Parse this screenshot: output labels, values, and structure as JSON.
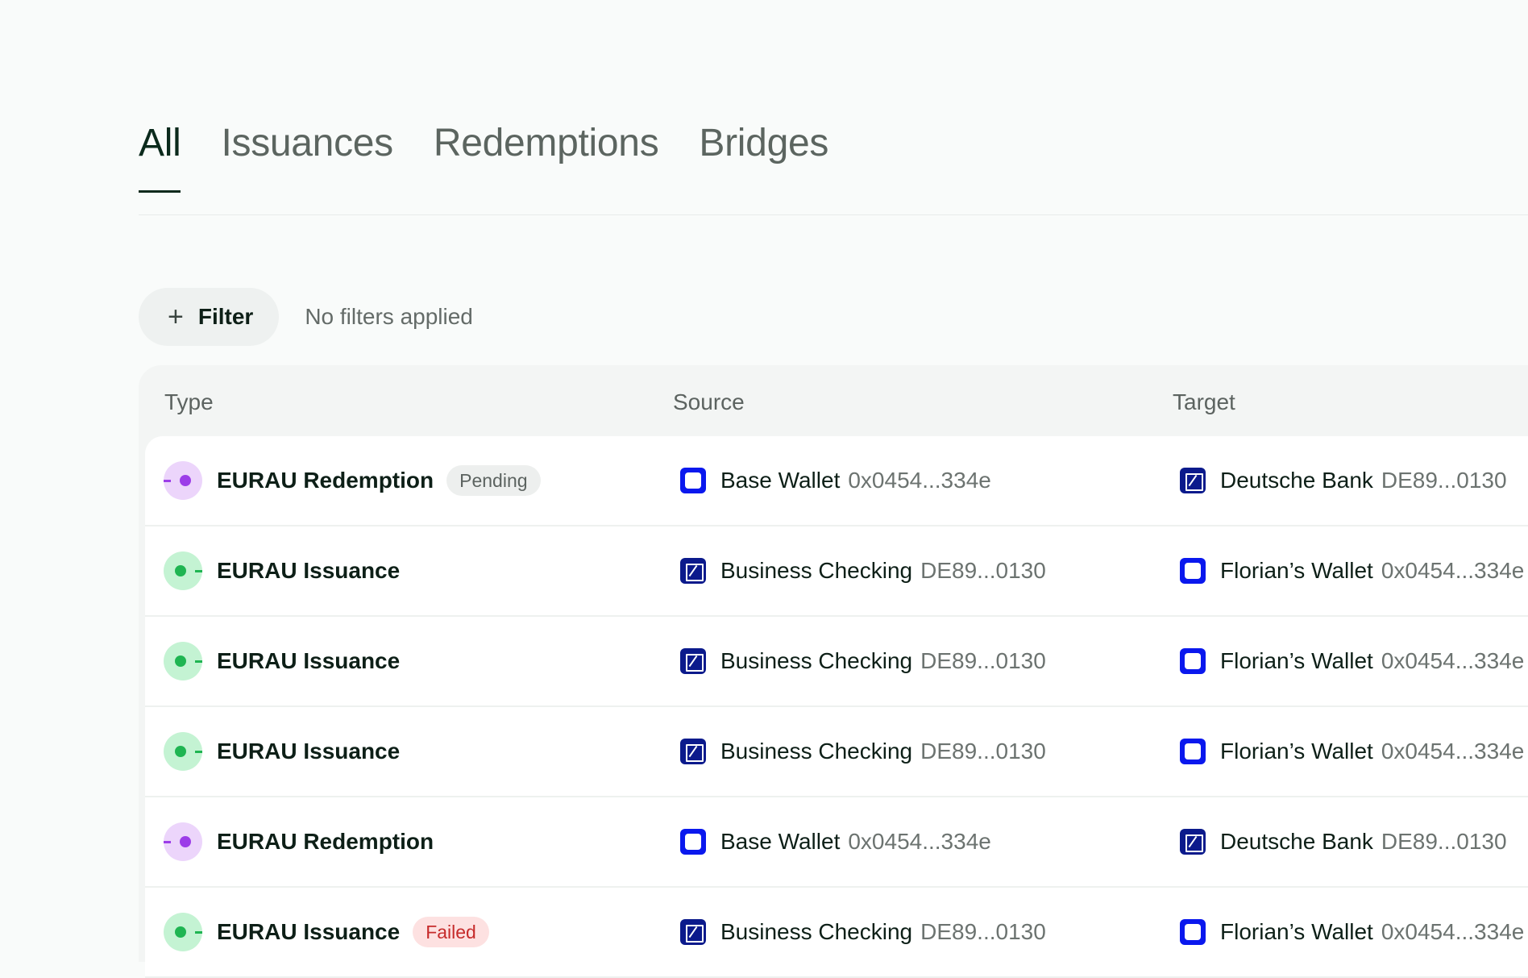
{
  "tabs": [
    {
      "label": "All",
      "active": true
    },
    {
      "label": "Issuances",
      "active": false
    },
    {
      "label": "Redemptions",
      "active": false
    },
    {
      "label": "Bridges",
      "active": false
    }
  ],
  "filter": {
    "button_label": "Filter",
    "status": "No filters applied"
  },
  "table": {
    "headers": {
      "type": "Type",
      "source": "Source",
      "target": "Target"
    },
    "rows": [
      {
        "kind": "redemption",
        "type": "EURAU Redemption",
        "badge": "Pending",
        "badge_kind": "pending",
        "source": {
          "icon": "wallet",
          "name": "Base Wallet",
          "id": "0x0454...334e"
        },
        "target": {
          "icon": "bank",
          "name": "Deutsche Bank",
          "id": "DE89...0130"
        }
      },
      {
        "kind": "issuance",
        "type": "EURAU Issuance",
        "badge": "",
        "badge_kind": "",
        "source": {
          "icon": "bank",
          "name": "Business Checking",
          "id": "DE89...0130"
        },
        "target": {
          "icon": "wallet",
          "name": "Florian’s Wallet",
          "id": "0x0454...334e"
        }
      },
      {
        "kind": "issuance",
        "type": "EURAU Issuance",
        "badge": "",
        "badge_kind": "",
        "source": {
          "icon": "bank",
          "name": "Business Checking",
          "id": "DE89...0130"
        },
        "target": {
          "icon": "wallet",
          "name": "Florian’s Wallet",
          "id": "0x0454...334e"
        }
      },
      {
        "kind": "issuance",
        "type": "EURAU Issuance",
        "badge": "",
        "badge_kind": "",
        "source": {
          "icon": "bank",
          "name": "Business Checking",
          "id": "DE89...0130"
        },
        "target": {
          "icon": "wallet",
          "name": "Florian’s Wallet",
          "id": "0x0454...334e"
        }
      },
      {
        "kind": "redemption",
        "type": "EURAU Redemption",
        "badge": "",
        "badge_kind": "",
        "source": {
          "icon": "wallet",
          "name": "Base Wallet",
          "id": "0x0454...334e"
        },
        "target": {
          "icon": "bank",
          "name": "Deutsche Bank",
          "id": "DE89...0130"
        }
      },
      {
        "kind": "issuance",
        "type": "EURAU Issuance",
        "badge": "Failed",
        "badge_kind": "failed",
        "source": {
          "icon": "bank",
          "name": "Business Checking",
          "id": "DE89...0130"
        },
        "target": {
          "icon": "wallet",
          "name": "Florian’s Wallet",
          "id": "0x0454...334e"
        }
      }
    ]
  }
}
